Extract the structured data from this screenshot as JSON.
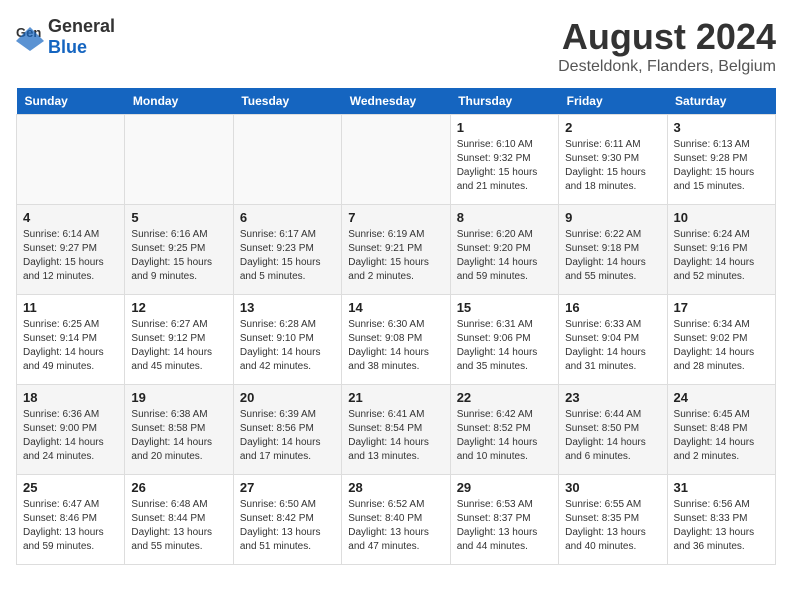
{
  "header": {
    "logo_general": "General",
    "logo_blue": "Blue",
    "month_year": "August 2024",
    "location": "Desteldonk, Flanders, Belgium"
  },
  "days_of_week": [
    "Sunday",
    "Monday",
    "Tuesday",
    "Wednesday",
    "Thursday",
    "Friday",
    "Saturday"
  ],
  "weeks": [
    [
      {
        "day": "",
        "sunrise": "",
        "sunset": "",
        "daylight": ""
      },
      {
        "day": "",
        "sunrise": "",
        "sunset": "",
        "daylight": ""
      },
      {
        "day": "",
        "sunrise": "",
        "sunset": "",
        "daylight": ""
      },
      {
        "day": "",
        "sunrise": "",
        "sunset": "",
        "daylight": ""
      },
      {
        "day": "1",
        "sunrise": "Sunrise: 6:10 AM",
        "sunset": "Sunset: 9:32 PM",
        "daylight": "Daylight: 15 hours and 21 minutes."
      },
      {
        "day": "2",
        "sunrise": "Sunrise: 6:11 AM",
        "sunset": "Sunset: 9:30 PM",
        "daylight": "Daylight: 15 hours and 18 minutes."
      },
      {
        "day": "3",
        "sunrise": "Sunrise: 6:13 AM",
        "sunset": "Sunset: 9:28 PM",
        "daylight": "Daylight: 15 hours and 15 minutes."
      }
    ],
    [
      {
        "day": "4",
        "sunrise": "Sunrise: 6:14 AM",
        "sunset": "Sunset: 9:27 PM",
        "daylight": "Daylight: 15 hours and 12 minutes."
      },
      {
        "day": "5",
        "sunrise": "Sunrise: 6:16 AM",
        "sunset": "Sunset: 9:25 PM",
        "daylight": "Daylight: 15 hours and 9 minutes."
      },
      {
        "day": "6",
        "sunrise": "Sunrise: 6:17 AM",
        "sunset": "Sunset: 9:23 PM",
        "daylight": "Daylight: 15 hours and 5 minutes."
      },
      {
        "day": "7",
        "sunrise": "Sunrise: 6:19 AM",
        "sunset": "Sunset: 9:21 PM",
        "daylight": "Daylight: 15 hours and 2 minutes."
      },
      {
        "day": "8",
        "sunrise": "Sunrise: 6:20 AM",
        "sunset": "Sunset: 9:20 PM",
        "daylight": "Daylight: 14 hours and 59 minutes."
      },
      {
        "day": "9",
        "sunrise": "Sunrise: 6:22 AM",
        "sunset": "Sunset: 9:18 PM",
        "daylight": "Daylight: 14 hours and 55 minutes."
      },
      {
        "day": "10",
        "sunrise": "Sunrise: 6:24 AM",
        "sunset": "Sunset: 9:16 PM",
        "daylight": "Daylight: 14 hours and 52 minutes."
      }
    ],
    [
      {
        "day": "11",
        "sunrise": "Sunrise: 6:25 AM",
        "sunset": "Sunset: 9:14 PM",
        "daylight": "Daylight: 14 hours and 49 minutes."
      },
      {
        "day": "12",
        "sunrise": "Sunrise: 6:27 AM",
        "sunset": "Sunset: 9:12 PM",
        "daylight": "Daylight: 14 hours and 45 minutes."
      },
      {
        "day": "13",
        "sunrise": "Sunrise: 6:28 AM",
        "sunset": "Sunset: 9:10 PM",
        "daylight": "Daylight: 14 hours and 42 minutes."
      },
      {
        "day": "14",
        "sunrise": "Sunrise: 6:30 AM",
        "sunset": "Sunset: 9:08 PM",
        "daylight": "Daylight: 14 hours and 38 minutes."
      },
      {
        "day": "15",
        "sunrise": "Sunrise: 6:31 AM",
        "sunset": "Sunset: 9:06 PM",
        "daylight": "Daylight: 14 hours and 35 minutes."
      },
      {
        "day": "16",
        "sunrise": "Sunrise: 6:33 AM",
        "sunset": "Sunset: 9:04 PM",
        "daylight": "Daylight: 14 hours and 31 minutes."
      },
      {
        "day": "17",
        "sunrise": "Sunrise: 6:34 AM",
        "sunset": "Sunset: 9:02 PM",
        "daylight": "Daylight: 14 hours and 28 minutes."
      }
    ],
    [
      {
        "day": "18",
        "sunrise": "Sunrise: 6:36 AM",
        "sunset": "Sunset: 9:00 PM",
        "daylight": "Daylight: 14 hours and 24 minutes."
      },
      {
        "day": "19",
        "sunrise": "Sunrise: 6:38 AM",
        "sunset": "Sunset: 8:58 PM",
        "daylight": "Daylight: 14 hours and 20 minutes."
      },
      {
        "day": "20",
        "sunrise": "Sunrise: 6:39 AM",
        "sunset": "Sunset: 8:56 PM",
        "daylight": "Daylight: 14 hours and 17 minutes."
      },
      {
        "day": "21",
        "sunrise": "Sunrise: 6:41 AM",
        "sunset": "Sunset: 8:54 PM",
        "daylight": "Daylight: 14 hours and 13 minutes."
      },
      {
        "day": "22",
        "sunrise": "Sunrise: 6:42 AM",
        "sunset": "Sunset: 8:52 PM",
        "daylight": "Daylight: 14 hours and 10 minutes."
      },
      {
        "day": "23",
        "sunrise": "Sunrise: 6:44 AM",
        "sunset": "Sunset: 8:50 PM",
        "daylight": "Daylight: 14 hours and 6 minutes."
      },
      {
        "day": "24",
        "sunrise": "Sunrise: 6:45 AM",
        "sunset": "Sunset: 8:48 PM",
        "daylight": "Daylight: 14 hours and 2 minutes."
      }
    ],
    [
      {
        "day": "25",
        "sunrise": "Sunrise: 6:47 AM",
        "sunset": "Sunset: 8:46 PM",
        "daylight": "Daylight: 13 hours and 59 minutes."
      },
      {
        "day": "26",
        "sunrise": "Sunrise: 6:48 AM",
        "sunset": "Sunset: 8:44 PM",
        "daylight": "Daylight: 13 hours and 55 minutes."
      },
      {
        "day": "27",
        "sunrise": "Sunrise: 6:50 AM",
        "sunset": "Sunset: 8:42 PM",
        "daylight": "Daylight: 13 hours and 51 minutes."
      },
      {
        "day": "28",
        "sunrise": "Sunrise: 6:52 AM",
        "sunset": "Sunset: 8:40 PM",
        "daylight": "Daylight: 13 hours and 47 minutes."
      },
      {
        "day": "29",
        "sunrise": "Sunrise: 6:53 AM",
        "sunset": "Sunset: 8:37 PM",
        "daylight": "Daylight: 13 hours and 44 minutes."
      },
      {
        "day": "30",
        "sunrise": "Sunrise: 6:55 AM",
        "sunset": "Sunset: 8:35 PM",
        "daylight": "Daylight: 13 hours and 40 minutes."
      },
      {
        "day": "31",
        "sunrise": "Sunrise: 6:56 AM",
        "sunset": "Sunset: 8:33 PM",
        "daylight": "Daylight: 13 hours and 36 minutes."
      }
    ]
  ]
}
